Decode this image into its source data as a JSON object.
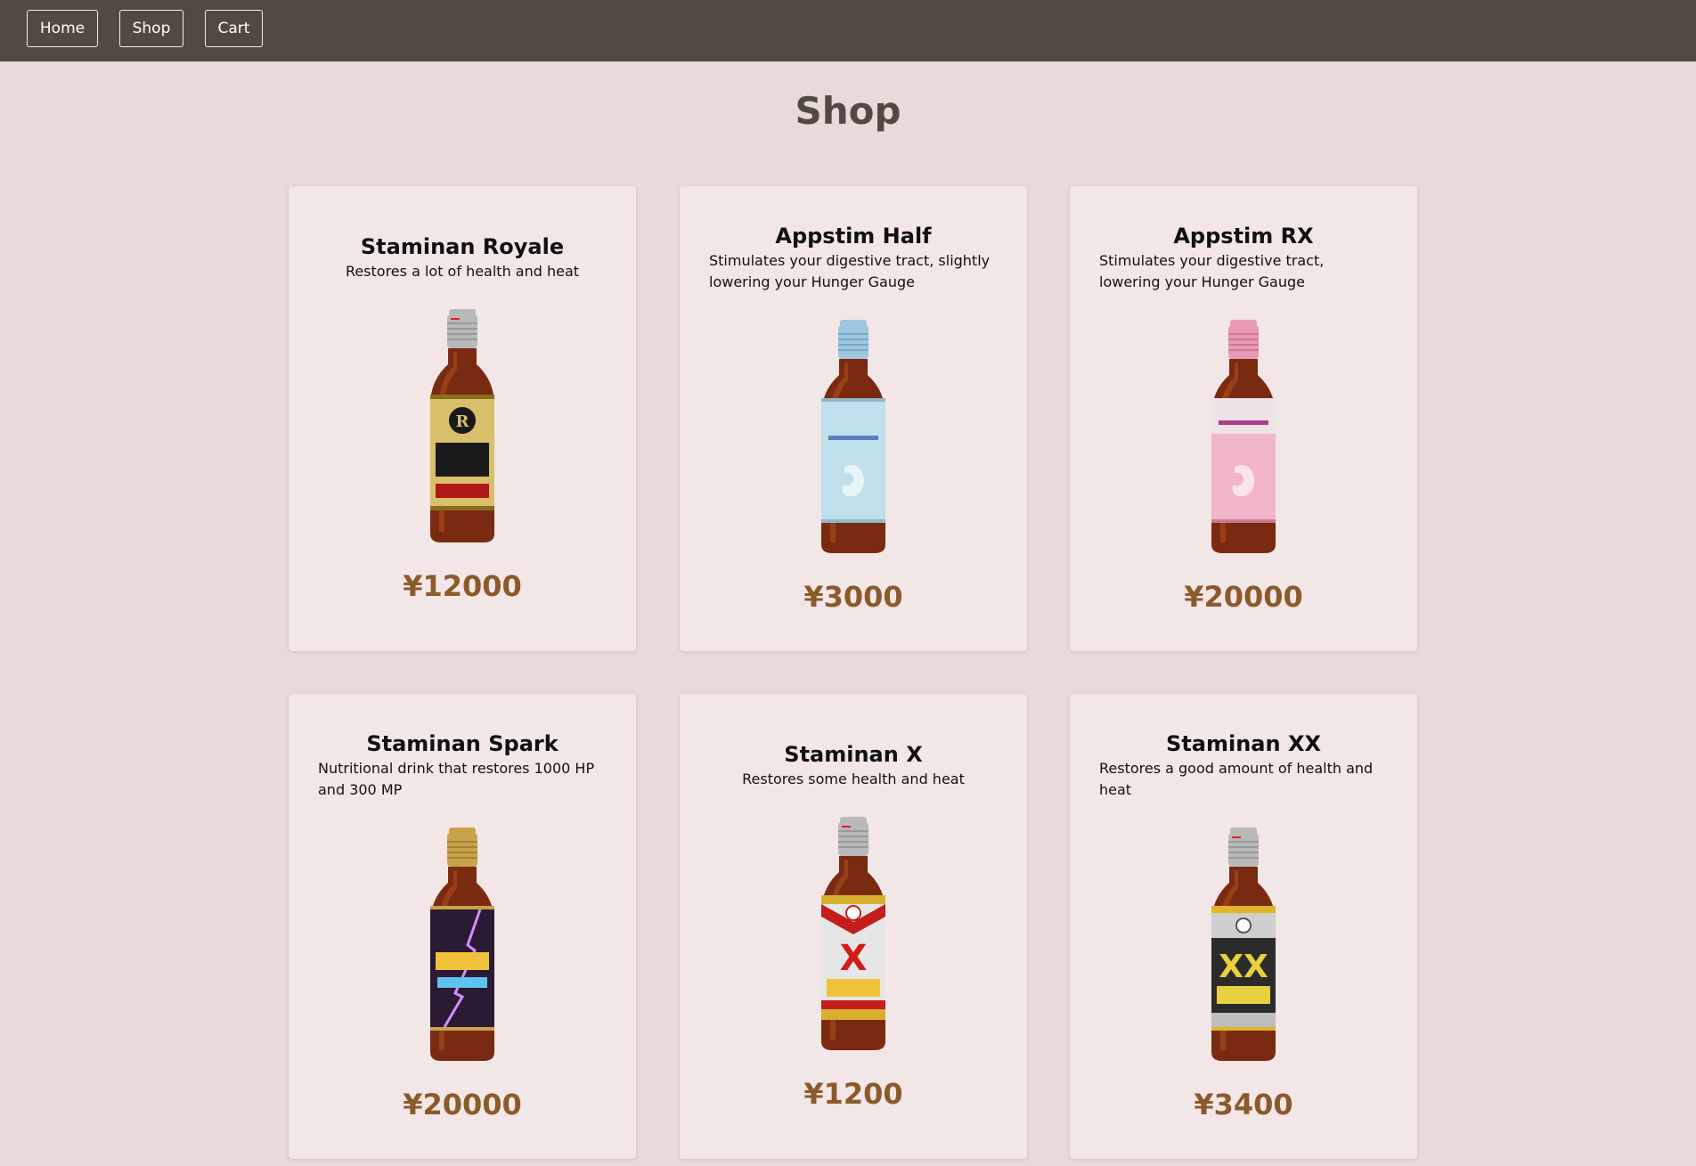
{
  "nav": {
    "home_label": "Home",
    "shop_label": "Shop",
    "cart_label": "Cart"
  },
  "page": {
    "title": "Shop"
  },
  "products": [
    {
      "name": "Staminan Royale",
      "description": "Restores a lot of health and heat",
      "price": "¥12000",
      "cap_color": "#b9b9b9",
      "label_color": "#d8c06a",
      "icon": "bottle-royale-icon"
    },
    {
      "name": "Appstim Half",
      "description": "Stimulates your digestive tract, slightly lowering your Hunger Gauge",
      "price": "¥3000",
      "cap_color": "#9ec6de",
      "label_color": "#bfe0ea",
      "icon": "bottle-half-icon"
    },
    {
      "name": "Appstim RX",
      "description": "Stimulates your digestive tract, lowering your Hunger Gauge",
      "price": "¥20000",
      "cap_color": "#e69ab5",
      "label_color": "#f0b5c8",
      "icon": "bottle-rx-icon"
    },
    {
      "name": "Staminan Spark",
      "description": "Nutritional drink that restores 1000 HP and 300 MP",
      "price": "¥20000",
      "cap_color": "#c9a24a",
      "label_color": "#2a1a33",
      "icon": "bottle-spark-icon"
    },
    {
      "name": "Staminan X",
      "description": "Restores some health and heat",
      "price": "¥1200",
      "cap_color": "#b9b9b9",
      "label_color": "#e6e6e6",
      "icon": "bottle-x-icon"
    },
    {
      "name": "Staminan XX",
      "description": "Restores a good amount of health and heat",
      "price": "¥3400",
      "cap_color": "#b9b9b9",
      "label_color": "#2b2b2b",
      "icon": "bottle-xx-icon"
    }
  ]
}
